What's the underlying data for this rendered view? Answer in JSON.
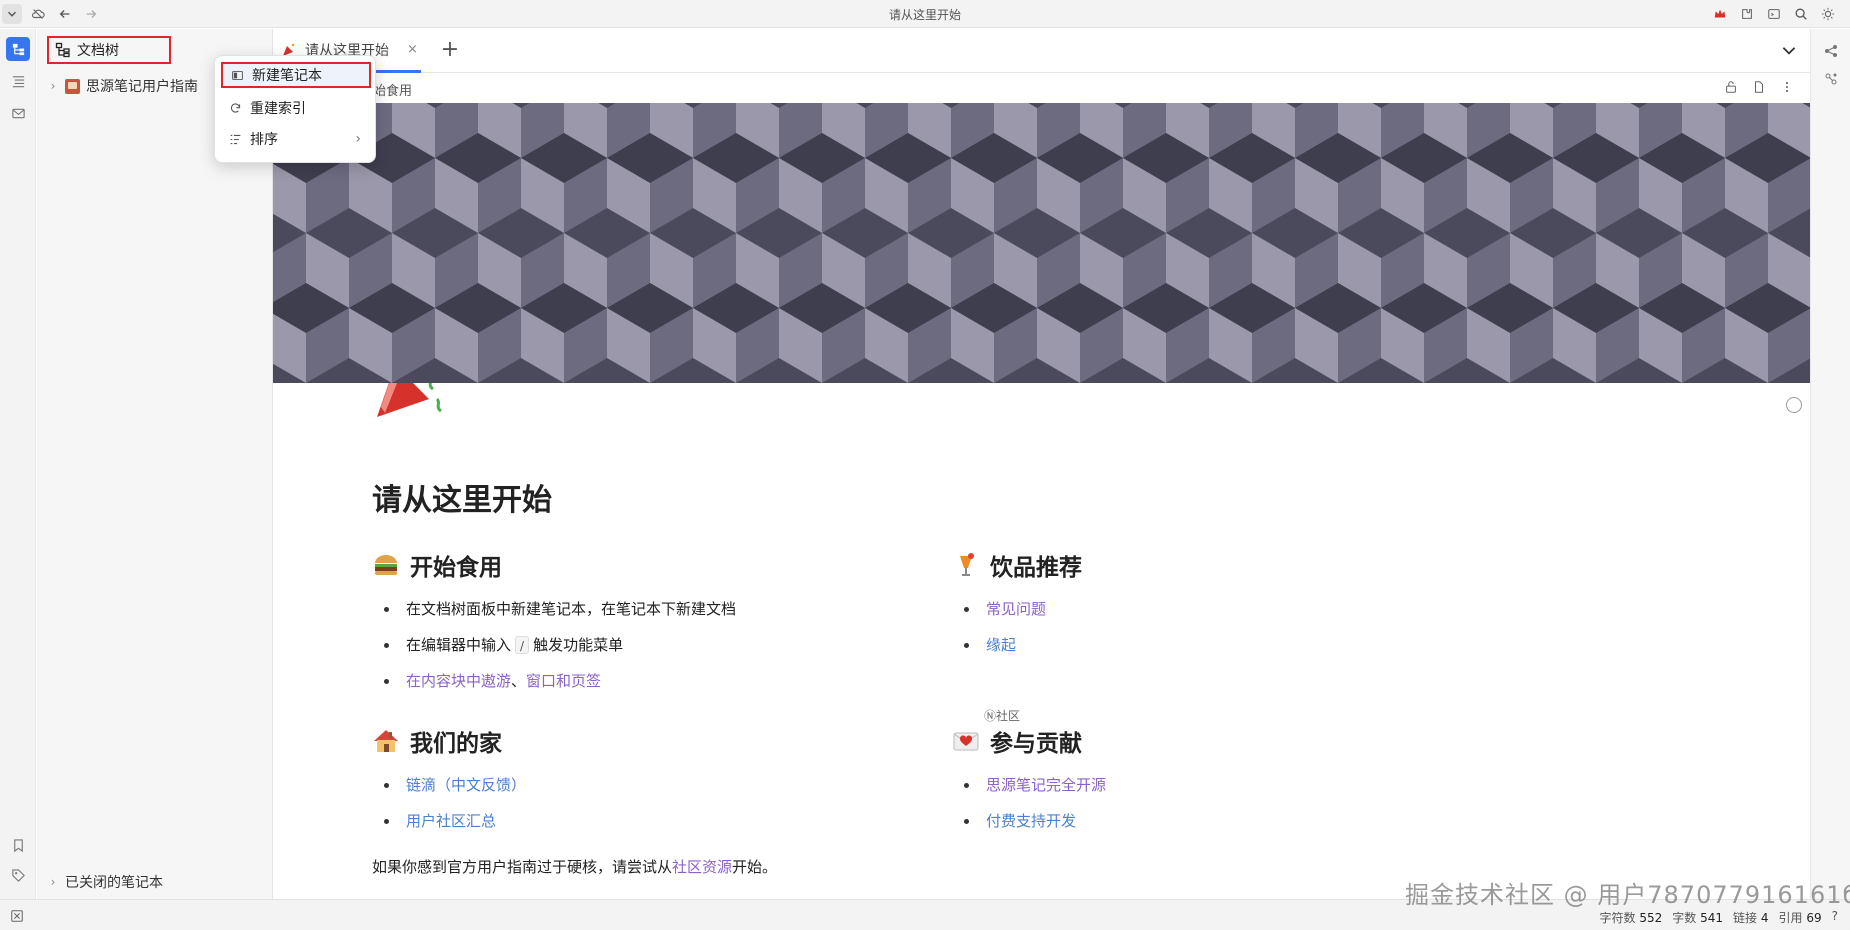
{
  "window": {
    "title": "请从这里开始"
  },
  "sidebar": {
    "header_label": "文档树",
    "notebook_label": "思源笔记用户指南",
    "closed_label": "已关闭的笔记本"
  },
  "context_menu": {
    "items": [
      {
        "label": "新建笔记本",
        "icon": "notebook-icon"
      },
      {
        "label": "重建索引",
        "icon": "refresh-icon"
      },
      {
        "label": "排序",
        "icon": "sort-icon"
      }
    ]
  },
  "tabs": {
    "active_label": "请从这里开始",
    "close_glyph": "×",
    "add_glyph": "+"
  },
  "breadcrumb": {
    "text": "始食用"
  },
  "doc": {
    "title": "请从这里开始",
    "sections": {
      "start": {
        "heading": "开始食用",
        "items": [
          "在文档树面板中新建笔记本，在笔记本下新建文档",
          "在编辑器中输入",
          "触发功能菜单"
        ],
        "kbd": "/",
        "link_a": "在内容块中遨游",
        "link_sep": "、",
        "link_b": "窗口和页签"
      },
      "drinks": {
        "heading": "饮品推荐",
        "items": [
          "常见问题",
          "缘起"
        ]
      },
      "home": {
        "heading": "我们的家",
        "items": [
          "链滴（中文反馈）",
          "用户社区汇总"
        ]
      },
      "contribute": {
        "heading": "参与贡献",
        "items": [
          "思源笔记完全开源",
          "付费支持开发"
        ]
      }
    },
    "inline_tag": "Ⓝ社区",
    "footer_prefix": "如果你感到官方用户指南过于硬核，请尝试从",
    "footer_link": "社区资源",
    "footer_suffix": "开始。"
  },
  "status": {
    "chars_label": "字符数",
    "chars": "552",
    "words_label": "字数",
    "words": "541",
    "links_label": "链接",
    "links": "4",
    "refs_label": "引用",
    "refs": "69"
  },
  "watermark": "掘金技术社区 @ 用户787077916161б",
  "colors": {
    "accent": "#3575f0",
    "highlight_border": "#e0262c",
    "link_blue": "#4a7fd1",
    "link_purple": "#8a62c8"
  }
}
